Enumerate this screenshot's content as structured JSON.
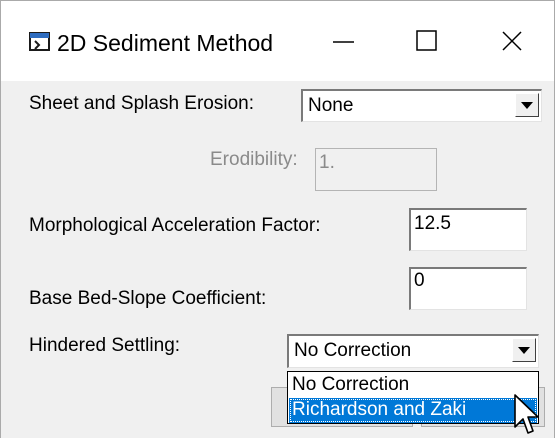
{
  "window": {
    "title": "2D Sediment Method",
    "icon": "app-window-icon",
    "controls": {
      "minimize_icon": "minimize-icon",
      "maximize_icon": "maximize-icon",
      "close_icon": "close-icon"
    }
  },
  "form": {
    "sheet_splash": {
      "label": "Sheet and Splash Erosion:",
      "value": "None"
    },
    "erodibility": {
      "label": "Erodibility:",
      "value": "1.",
      "enabled": false
    },
    "morph_accel": {
      "label": "Morphological Acceleration Factor:",
      "value": "12.5"
    },
    "bed_slope": {
      "label": "Base Bed-Slope Coefficient:",
      "value": "0"
    },
    "hindered_settling": {
      "label": "Hindered Settling:",
      "value": "No Correction",
      "options": [
        "No Correction",
        "Richardson and Zaki"
      ],
      "highlighted": "Richardson and Zaki"
    }
  },
  "colors": {
    "selection": "#0078d7",
    "window_bg": "#f0f0f0",
    "titlebar_bg": "#ffffff"
  }
}
